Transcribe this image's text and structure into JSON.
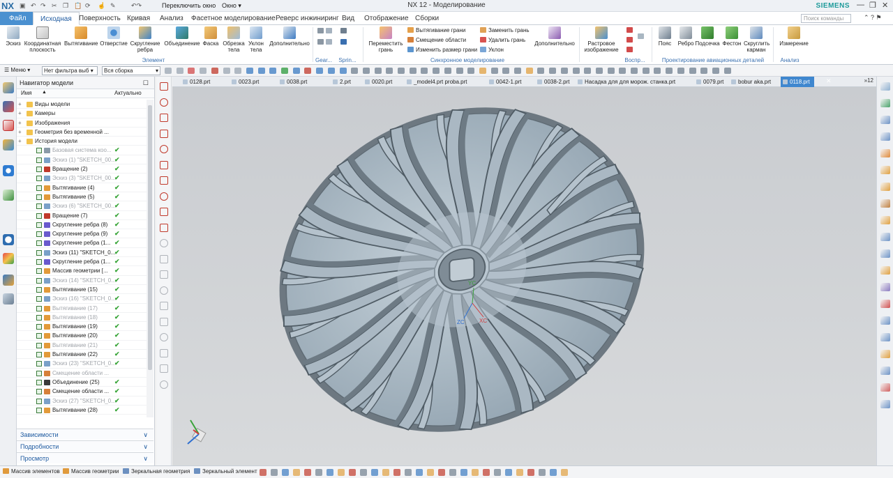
{
  "app": {
    "logo": "NX",
    "title": "NX 12 - Моделирование",
    "brand": "SIEMENS",
    "switch_window": "Переключить окно",
    "window_menu": "Окно"
  },
  "tabs": [
    "Файл",
    "Исходная",
    "Поверхность",
    "Кривая",
    "Анализ",
    "Фасетное моделирование",
    "Реверс инжиниринг",
    "Вид",
    "Отображение",
    "Сборки"
  ],
  "search_placeholder": "Поиск команды",
  "ribbon": {
    "buttons": [
      "Эскиз",
      "Координатная плоскость",
      "Вытягивание",
      "Отверстие",
      "Скругление ребра",
      "Объединение",
      "Фаска",
      "Обрезка тела",
      "Уклон тела",
      "Дополнительно",
      "Переместить грань",
      "Дополнительно",
      "Растровое изображение",
      "Пояс",
      "Ребро",
      "Подсечка",
      "Фестон",
      "Скруглить карман",
      "Измерение"
    ],
    "sync_small": [
      "Вытягивание грани",
      "Смещение области",
      "Изменить размер грани",
      "Заменить грань",
      "Удалить грань",
      "Уклон"
    ],
    "groups": [
      "Элемент",
      "Gear...",
      "Sprin...",
      "Синхронное моделирование",
      "Воспр...",
      "Проектирование авиационных деталей",
      "Анализ"
    ]
  },
  "toolbar2": {
    "menu": "Меню",
    "filter": "Нет фильтра выб",
    "scope": "Вся сборка"
  },
  "navigator": {
    "title": "Навигатор модели",
    "col_name": "Имя",
    "col_actual": "Актуально",
    "rows": [
      {
        "label": "Виды модели",
        "type": "folder",
        "dim": false,
        "ok": false,
        "lvl": 0
      },
      {
        "label": "Камеры",
        "type": "folder",
        "dim": false,
        "ok": false,
        "lvl": 0
      },
      {
        "label": "Изображения",
        "type": "folder",
        "dim": false,
        "ok": false,
        "lvl": 0
      },
      {
        "label": "Геометрия без временной ...",
        "type": "folder",
        "dim": false,
        "ok": false,
        "lvl": 0
      },
      {
        "label": "История модели",
        "type": "folder",
        "dim": false,
        "ok": false,
        "lvl": 0
      },
      {
        "label": "Базовая система коо...",
        "type": "csys",
        "dim": true,
        "ok": true,
        "lvl": 1
      },
      {
        "label": "Эскиз (1) \"SKETCH_00...",
        "type": "sketch",
        "dim": true,
        "ok": true,
        "lvl": 1
      },
      {
        "label": "Вращение (2)",
        "type": "rev",
        "dim": false,
        "ok": true,
        "lvl": 1
      },
      {
        "label": "Эскиз (3) \"SKETCH_00...",
        "type": "sketch",
        "dim": true,
        "ok": true,
        "lvl": 1
      },
      {
        "label": "Вытягивание (4)",
        "type": "ext",
        "dim": false,
        "ok": true,
        "lvl": 1
      },
      {
        "label": "Вытягивание (5)",
        "type": "ext",
        "dim": false,
        "ok": true,
        "lvl": 1
      },
      {
        "label": "Эскиз (6) \"SKETCH_00...",
        "type": "sketch",
        "dim": true,
        "ok": true,
        "lvl": 1
      },
      {
        "label": "Вращение (7)",
        "type": "rev",
        "dim": false,
        "ok": true,
        "lvl": 1
      },
      {
        "label": "Скругление ребра (8)",
        "type": "blend",
        "dim": false,
        "ok": true,
        "lvl": 1
      },
      {
        "label": "Скругление ребра (9)",
        "type": "blend",
        "dim": false,
        "ok": true,
        "lvl": 1
      },
      {
        "label": "Скругление ребра (1...",
        "type": "blend",
        "dim": false,
        "ok": true,
        "lvl": 1
      },
      {
        "label": "Эскиз (11) \"SKETCH_0...",
        "type": "sketch",
        "dim": false,
        "ok": true,
        "lvl": 1
      },
      {
        "label": "Скругление ребра (1...",
        "type": "blend",
        "dim": false,
        "ok": true,
        "lvl": 1
      },
      {
        "label": "Массив геометрии [...",
        "type": "pattern",
        "dim": false,
        "ok": true,
        "lvl": 1
      },
      {
        "label": "Эскиз (14) \"SKETCH_0...",
        "type": "sketch",
        "dim": true,
        "ok": true,
        "lvl": 1
      },
      {
        "label": "Вытягивание (15)",
        "type": "ext",
        "dim": false,
        "ok": true,
        "lvl": 1
      },
      {
        "label": "Эскиз (16) \"SKETCH_0...",
        "type": "sketch",
        "dim": true,
        "ok": true,
        "lvl": 1
      },
      {
        "label": "Вытягивание (17)",
        "type": "ext",
        "dim": true,
        "ok": true,
        "lvl": 1
      },
      {
        "label": "Вытягивание (18)",
        "type": "ext",
        "dim": true,
        "ok": true,
        "lvl": 1
      },
      {
        "label": "Вытягивание (19)",
        "type": "ext",
        "dim": false,
        "ok": true,
        "lvl": 1
      },
      {
        "label": "Вытягивание (20)",
        "type": "ext",
        "dim": false,
        "ok": true,
        "lvl": 1
      },
      {
        "label": "Вытягивание (21)",
        "type": "ext",
        "dim": true,
        "ok": true,
        "lvl": 1
      },
      {
        "label": "Вытягивание (22)",
        "type": "ext",
        "dim": false,
        "ok": true,
        "lvl": 1
      },
      {
        "label": "Эскиз (23) \"SKETCH_0...",
        "type": "sketch",
        "dim": true,
        "ok": true,
        "lvl": 1
      },
      {
        "label": "Смещение области ...",
        "type": "offset",
        "dim": true,
        "ok": false,
        "lvl": 1
      },
      {
        "label": "Объединение (25)",
        "type": "unite",
        "dim": false,
        "ok": true,
        "lvl": 1
      },
      {
        "label": "Смещение области ...",
        "type": "offset",
        "dim": false,
        "ok": true,
        "lvl": 1
      },
      {
        "label": "Эскиз (27) \"SKETCH_0...",
        "type": "sketch",
        "dim": true,
        "ok": true,
        "lvl": 1
      },
      {
        "label": "Вытягивание (28)",
        "type": "ext",
        "dim": false,
        "ok": true,
        "lvl": 1
      }
    ],
    "panels": [
      "Зависимости",
      "Подробности",
      "Просмотр"
    ]
  },
  "doc_tabs": [
    "0128.prt",
    "0023.prt",
    "0038.prt",
    "2.prt",
    "0020.prt",
    "_model4.prt proba.prt",
    "0042-1.prt",
    "0038-2.prt",
    "Насадка для для морож. станка.prt",
    "0079.prt",
    "bobur aka.prt",
    "0118.prt"
  ],
  "doc_overflow": "»12",
  "axes": {
    "zc": "ZC",
    "xc": "XC",
    "yc": "YC"
  },
  "status": [
    "Массив элементов",
    "Массив геометрии",
    "Зеркальная геометрия",
    "Зеркальный элемент"
  ],
  "colors": {
    "accent": "#3f87cf",
    "file_tab": "#4a90d0",
    "model": "#a9b7c2",
    "ok": "#39a539"
  }
}
